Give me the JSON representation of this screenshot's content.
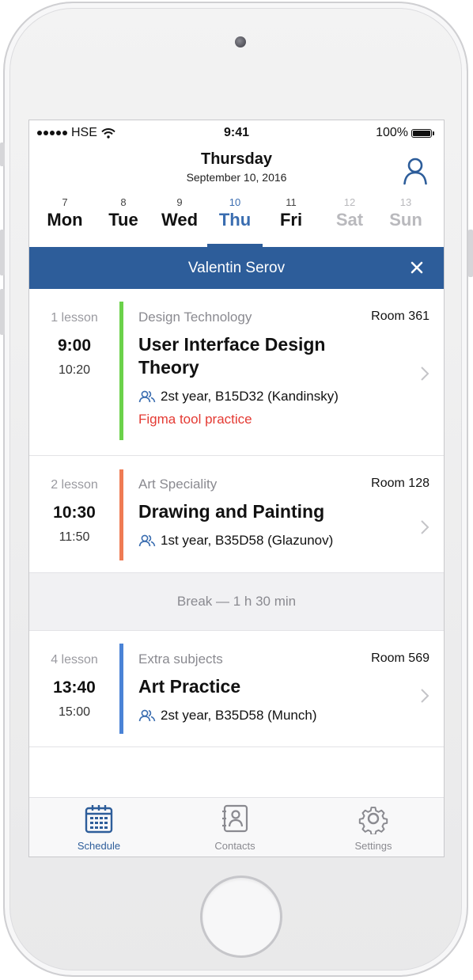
{
  "status_bar": {
    "carrier": "HSE",
    "time": "9:41",
    "battery": "100%"
  },
  "header": {
    "title": "Thursday",
    "date": "September 10, 2016"
  },
  "days": [
    {
      "num": "7",
      "name": "Mon"
    },
    {
      "num": "8",
      "name": "Tue"
    },
    {
      "num": "9",
      "name": "Wed"
    },
    {
      "num": "10",
      "name": "Thu"
    },
    {
      "num": "11",
      "name": "Fri"
    },
    {
      "num": "12",
      "name": "Sat"
    },
    {
      "num": "13",
      "name": "Sun"
    }
  ],
  "active_day": "Thu",
  "banner": {
    "name": "Valentin Serov"
  },
  "lessons": [
    {
      "index": "1 lesson",
      "start": "9:00",
      "end": "10:20",
      "subject": "Design Technology",
      "room": "Room 361",
      "title": "User Interface Design Theory",
      "group": "2st year, B15D32 (Kandinsky)",
      "note": "Figma tool practice",
      "color": "#6bd24a"
    },
    {
      "index": "2 lesson",
      "start": "10:30",
      "end": "11:50",
      "subject": "Art Speciality",
      "room": "Room 128",
      "title": "Drawing and Painting",
      "group": "1st year, B35D58 (Glazunov)",
      "color": "#ef7b54"
    },
    {
      "index": "4 lesson",
      "start": "13:40",
      "end": "15:00",
      "subject": "Extra subjects",
      "room": "Room 569",
      "title": "Art Practice",
      "group": "2st year, B35D58 (Munch)",
      "color": "#4a83d6"
    }
  ],
  "break_text": "Break — 1 h 30 min",
  "tabs": [
    {
      "label": "Schedule"
    },
    {
      "label": "Contacts"
    },
    {
      "label": "Settings"
    }
  ],
  "colors": {
    "accent": "#2d5d9a",
    "note": "#e43a33",
    "weekend": "#b9b9bd"
  }
}
